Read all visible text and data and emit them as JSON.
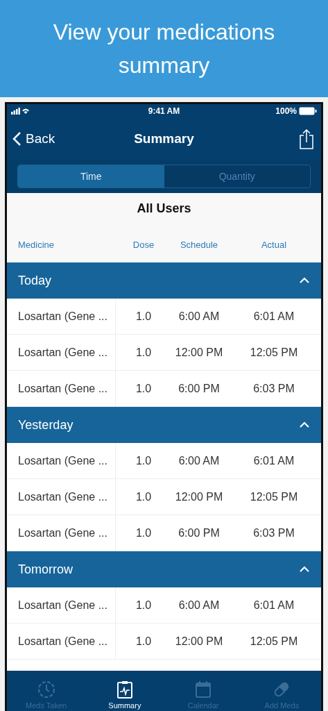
{
  "banner": {
    "title": "View your medications summary"
  },
  "status_bar": {
    "time": "9:41 AM",
    "battery": "100%"
  },
  "nav": {
    "back": "Back",
    "title": "Summary"
  },
  "segments": [
    {
      "label": "Time",
      "selected": true
    },
    {
      "label": "Quantity",
      "selected": false
    }
  ],
  "heading": "All Users",
  "columns": [
    "Medicine",
    "Dose",
    "Schedule",
    "Actual"
  ],
  "sections": [
    {
      "title": "Today",
      "expanded": true,
      "rows": [
        {
          "medicine": "Losartan (Gene ...",
          "dose": "1.0",
          "schedule": "6:00 AM",
          "actual": "6:01 AM"
        },
        {
          "medicine": "Losartan (Gene ...",
          "dose": "1.0",
          "schedule": "12:00 PM",
          "actual": "12:05 PM"
        },
        {
          "medicine": "Losartan (Gene ...",
          "dose": "1.0",
          "schedule": "6:00 PM",
          "actual": "6:03 PM"
        }
      ]
    },
    {
      "title": "Yesterday",
      "expanded": true,
      "rows": [
        {
          "medicine": "Losartan (Gene ...",
          "dose": "1.0",
          "schedule": "6:00 AM",
          "actual": "6:01 AM"
        },
        {
          "medicine": "Losartan (Gene ...",
          "dose": "1.0",
          "schedule": "12:00 PM",
          "actual": "12:05 PM"
        },
        {
          "medicine": "Losartan (Gene ...",
          "dose": "1.0",
          "schedule": "6:00 PM",
          "actual": "6:03 PM"
        }
      ]
    },
    {
      "title": "Tomorrow",
      "expanded": true,
      "rows": [
        {
          "medicine": "Losartan (Gene ...",
          "dose": "1.0",
          "schedule": "6:00 AM",
          "actual": "6:01 AM"
        },
        {
          "medicine": "Losartan (Gene ...",
          "dose": "1.0",
          "schedule": "12:00 PM",
          "actual": "12:05 PM"
        }
      ]
    }
  ],
  "tab_bar": [
    {
      "label": "Meds Taken",
      "kind": "clock",
      "selected": false
    },
    {
      "label": "Summary",
      "kind": "clipboard",
      "selected": true
    },
    {
      "label": "Calendar",
      "kind": "calendar",
      "selected": false
    },
    {
      "label": "Add Meds",
      "kind": "pill",
      "selected": false
    }
  ]
}
